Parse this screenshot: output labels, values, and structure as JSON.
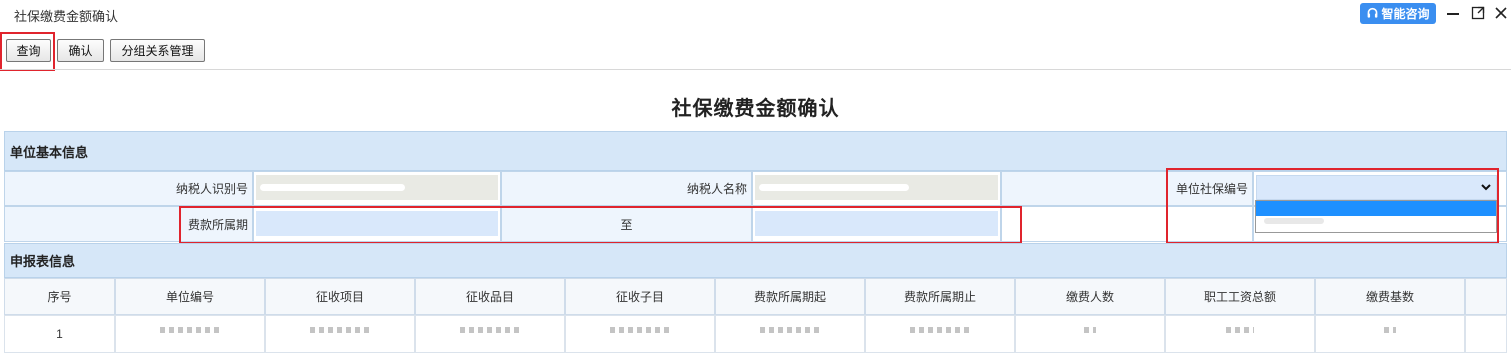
{
  "window": {
    "title": "社保缴费金额确认",
    "ai_button": "智能咨询"
  },
  "toolbar": {
    "query": "查询",
    "confirm": "确认",
    "group": "分组关系管理"
  },
  "page": {
    "title": "社保缴费金额确认"
  },
  "unit_info": {
    "heading": "单位基本信息",
    "taxpayer_id_label": "纳税人识别号",
    "taxpayer_name_label": "纳税人名称",
    "social_no_label": "单位社保编号",
    "period_label": "费款所属期",
    "to_label": "至"
  },
  "report": {
    "heading": "申报表信息",
    "columns": [
      "序号",
      "单位编号",
      "征收项目",
      "征收品目",
      "征收子目",
      "费款所属期起",
      "费款所属期止",
      "缴费人数",
      "职工工资总额",
      "缴费基数"
    ],
    "rows": [
      [
        "1",
        "",
        "",
        "",
        "",
        "",
        "",
        "",
        "",
        ""
      ]
    ]
  },
  "colors": {
    "accent": "#3a8ef0",
    "highlight": "#e0242d",
    "section_bg": "#d6e7f8",
    "input_bg": "#d9e8fb"
  },
  "icons": {
    "ai": "headset-icon",
    "minimize": "minimize-icon",
    "maximize": "maximize-icon",
    "close": "close-icon",
    "select": "chevron-down-icon"
  }
}
